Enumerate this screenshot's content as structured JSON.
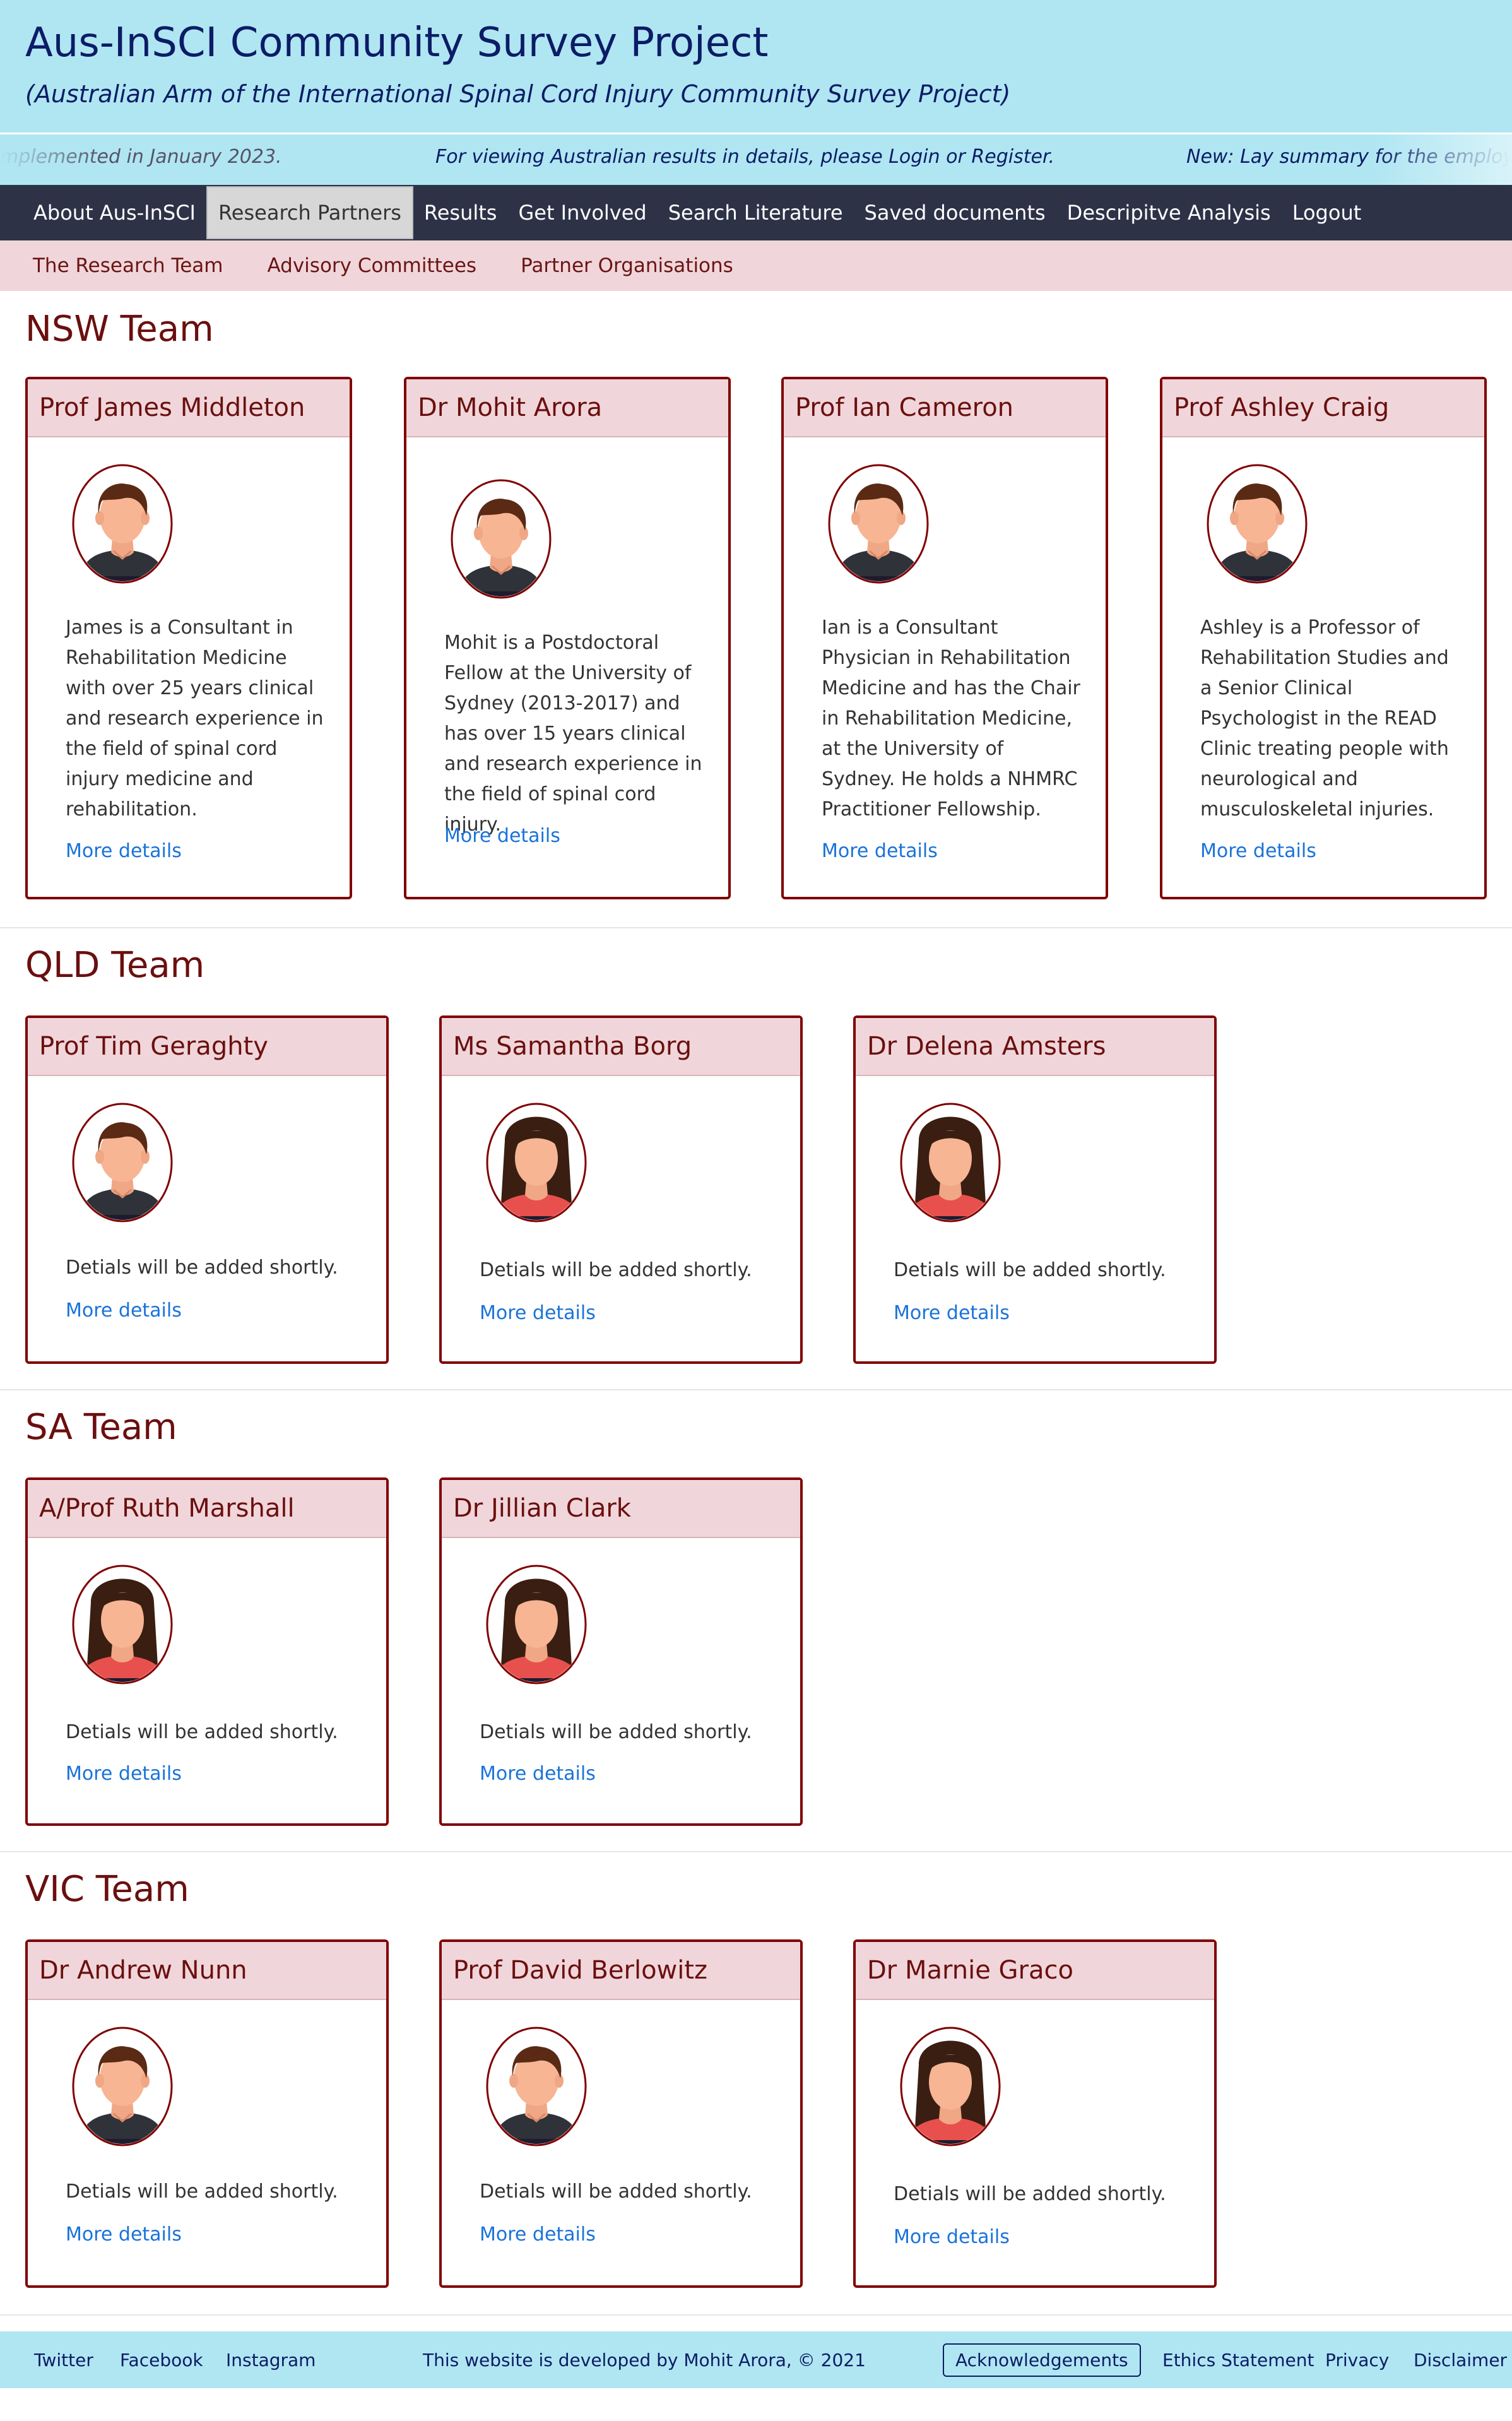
{
  "header": {
    "title": "Aus-InSCI Community Survey Project",
    "subtitle": "(Australian Arm of the International Spinal Cord Injury Community Survey Project)"
  },
  "ticker": {
    "left": "mplemented in January 2023.",
    "center": "For viewing Australian results in details, please Login or Register.",
    "right": "New: Lay summary for the employ"
  },
  "nav": {
    "items": [
      "About Aus-InSCI",
      "Research Partners",
      "Results",
      "Get Involved",
      "Search Literature",
      "Saved documents",
      "Descripitve Analysis",
      "Logout"
    ],
    "active": "Research Partners"
  },
  "subnav": {
    "items": [
      "The Research Team",
      "Advisory Committees",
      "Partner Organisations"
    ]
  },
  "sections": {
    "nsw": {
      "title": "NSW Team",
      "members": [
        {
          "name": "Prof James Middleton",
          "bio": "James is a Consultant in Rehabilitation Medicine with over 25 years clinical and research experience in the field of spinal cord injury medicine and rehabilitation.",
          "link": "More details",
          "avatar": "male-avatar-icon"
        },
        {
          "name": "Dr Mohit Arora",
          "bio": "Mohit is a Postdoctoral Fellow at the University of Sydney (2013-2017) and has over 15 years clinical and research experience in the field of spinal cord injury.",
          "link": "More details",
          "avatar": "male-avatar-icon"
        },
        {
          "name": "Prof Ian Cameron",
          "bio": "Ian is a Consultant Physician in Rehabilitation Medicine and has the Chair in Rehabilitation Medicine, at the University of Sydney. He holds a NHMRC Practitioner Fellowship.",
          "link": "More details",
          "avatar": "male-avatar-icon"
        },
        {
          "name": "Prof Ashley Craig",
          "bio": "Ashley is a Professor of Rehabilitation Studies and a Senior Clinical Psychologist in the READ Clinic treating people with neurological and musculoskeletal injuries.",
          "link": "More details",
          "avatar": "male-avatar-icon"
        }
      ]
    },
    "qld": {
      "title": "QLD Team",
      "members": [
        {
          "name": "Prof Tim Geraghty",
          "bio": "Detials will be added shortly.",
          "link": "More details",
          "avatar": "male-avatar-icon"
        },
        {
          "name": "Ms Samantha Borg",
          "bio": "Detials will be added shortly.",
          "link": "More details",
          "avatar": "female-avatar-icon"
        },
        {
          "name": "Dr Delena Amsters",
          "bio": "Detials will be added shortly.",
          "link": "More details",
          "avatar": "female-avatar-icon"
        }
      ]
    },
    "sa": {
      "title": "SA Team",
      "members": [
        {
          "name": "A/Prof Ruth Marshall",
          "bio": "Detials will be added shortly.",
          "link": "More details",
          "avatar": "female-avatar-icon"
        },
        {
          "name": "Dr Jillian Clark",
          "bio": "Detials will be added shortly.",
          "link": "More details",
          "avatar": "female-avatar-icon"
        }
      ]
    },
    "vic": {
      "title": "VIC Team",
      "members": [
        {
          "name": "Dr Andrew Nunn",
          "bio": "Detials will be added shortly.",
          "link": "More details",
          "avatar": "male-avatar-icon"
        },
        {
          "name": "Prof David Berlowitz",
          "bio": "Detials will be added shortly.",
          "link": "More details",
          "avatar": "male-avatar-icon"
        },
        {
          "name": "Dr Marnie Graco",
          "bio": "Detials will be added shortly.",
          "link": "More details",
          "avatar": "female-avatar-icon"
        }
      ]
    }
  },
  "footer": {
    "twitter": "Twitter",
    "facebook": "Facebook",
    "instagram": "Instagram",
    "credit": "This website is developed by Mohit Arora, © 2021",
    "acknowledgements": "Acknowledgements",
    "ethics": "Ethics Statement",
    "privacy": "Privacy",
    "disclaimer": "Disclaimer"
  },
  "colors": {
    "header_bg": "#b0e6f2",
    "nav_bg": "#2d3247",
    "accent": "#800000",
    "link": "#1a73d9",
    "subnav_bg": "#f0d6da"
  }
}
